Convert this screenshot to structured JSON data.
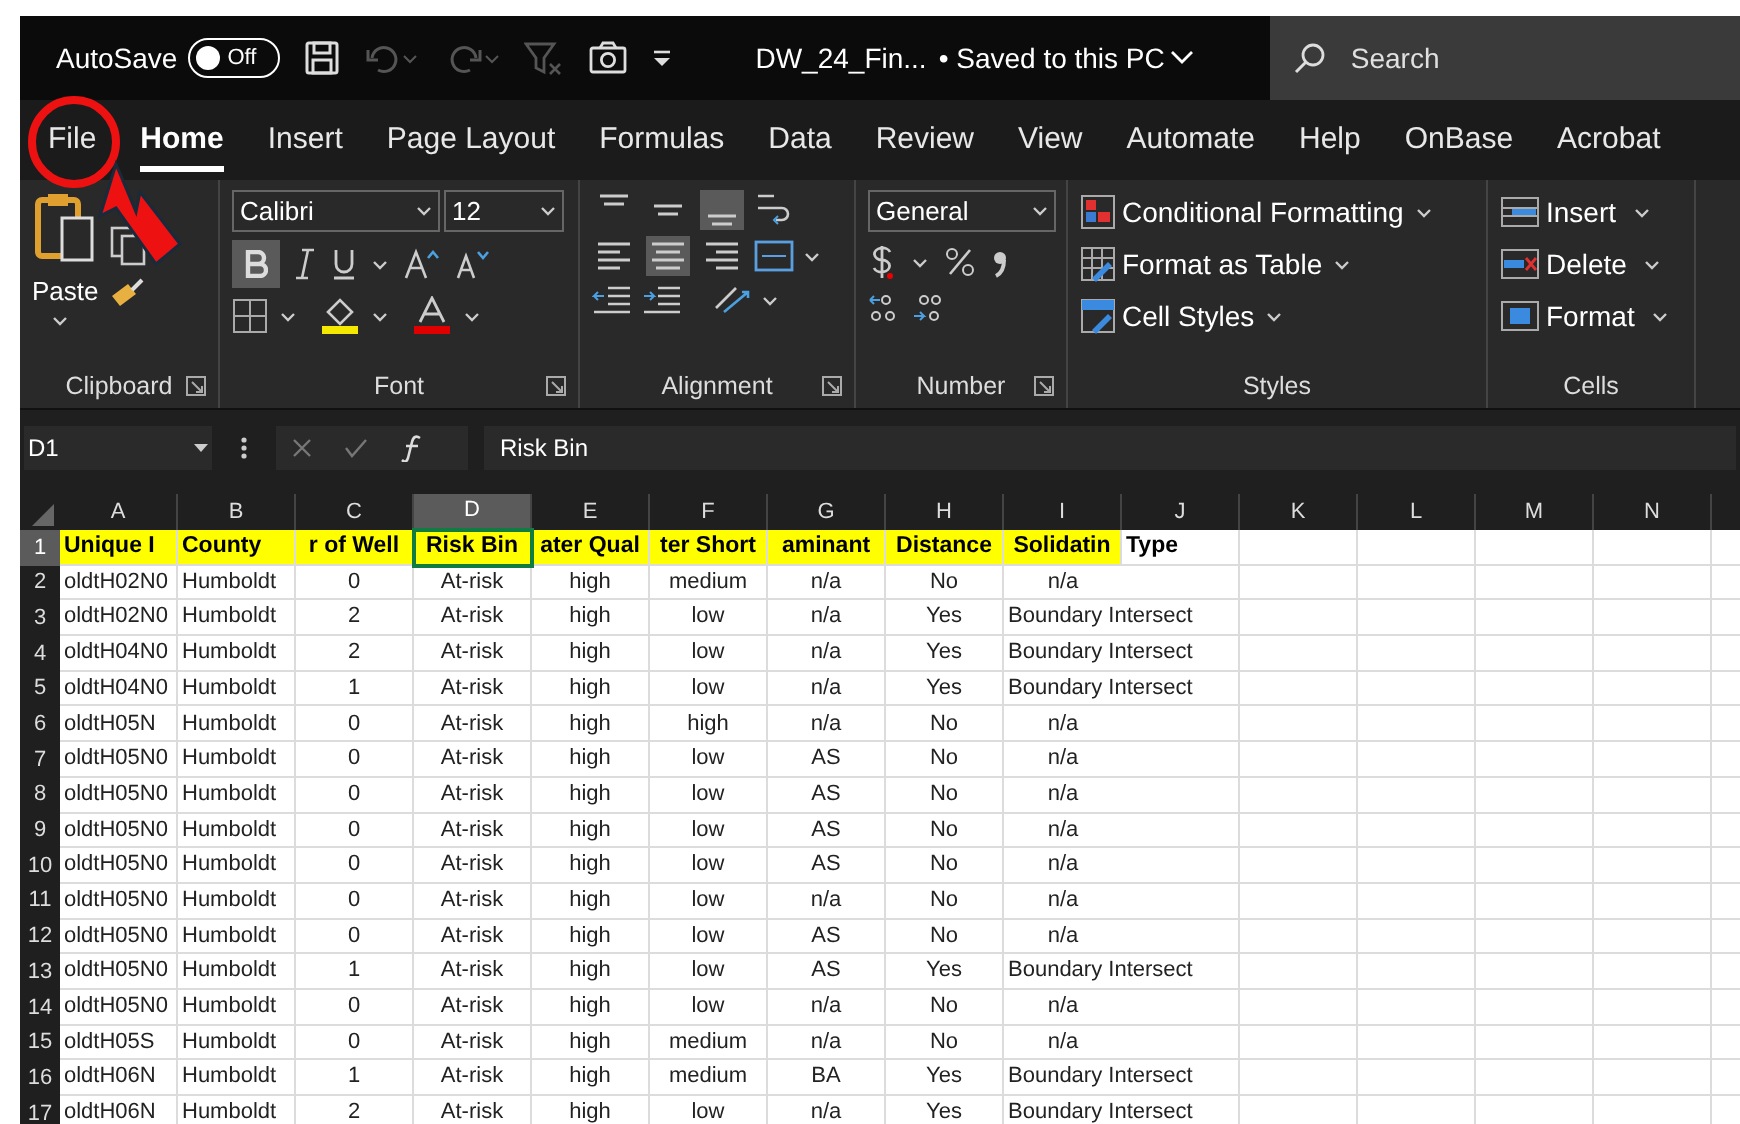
{
  "title_bar": {
    "autosave_label": "AutoSave",
    "autosave": {
      "on": false,
      "label": "Off"
    },
    "document_title": "DW_24_Fin...",
    "save_status": "• Saved to this PC",
    "search_placeholder": "Search"
  },
  "ribbon_tabs": [
    {
      "label": "File",
      "selected": false
    },
    {
      "label": "Home",
      "selected": true
    },
    {
      "label": "Insert",
      "selected": false
    },
    {
      "label": "Page Layout",
      "selected": false
    },
    {
      "label": "Formulas",
      "selected": false
    },
    {
      "label": "Data",
      "selected": false
    },
    {
      "label": "Review",
      "selected": false
    },
    {
      "label": "View",
      "selected": false
    },
    {
      "label": "Automate",
      "selected": false
    },
    {
      "label": "Help",
      "selected": false
    },
    {
      "label": "OnBase",
      "selected": false
    },
    {
      "label": "Acrobat",
      "selected": false
    }
  ],
  "ribbon": {
    "clipboard": {
      "paste_label": "Paste",
      "group_label": "Clipboard"
    },
    "font": {
      "name": "Calibri",
      "size": "12",
      "bold": true,
      "group_label": "Font"
    },
    "alignment": {
      "group_label": "Alignment"
    },
    "number": {
      "format": "General",
      "group_label": "Number"
    },
    "styles": {
      "items": [
        "Conditional Formatting",
        "Format as Table",
        "Cell Styles"
      ],
      "group_label": "Styles"
    },
    "cells": {
      "items": [
        "Insert",
        "Delete",
        "Format"
      ],
      "group_label": "Cells"
    }
  },
  "formula_bar": {
    "name_box": "D1",
    "formula": "Risk Bin"
  },
  "sheet": {
    "columns": [
      {
        "label": "A",
        "selected": false
      },
      {
        "label": "B",
        "selected": false
      },
      {
        "label": "C",
        "selected": false
      },
      {
        "label": "D",
        "selected": true
      },
      {
        "label": "E",
        "selected": false
      },
      {
        "label": "F",
        "selected": false
      },
      {
        "label": "G",
        "selected": false
      },
      {
        "label": "H",
        "selected": false
      },
      {
        "label": "I",
        "selected": false
      },
      {
        "label": "J",
        "selected": false
      },
      {
        "label": "K",
        "selected": false
      },
      {
        "label": "L",
        "selected": false
      },
      {
        "label": "M",
        "selected": false
      },
      {
        "label": "N",
        "selected": false
      }
    ],
    "rows": [
      {
        "number": "1",
        "kind": "header",
        "selected": true,
        "cells": [
          {
            "text": "Unique I",
            "highlight": true
          },
          {
            "text": "County",
            "highlight": true
          },
          {
            "text": "r of Well",
            "highlight": true
          },
          {
            "text": "Risk Bin",
            "highlight": true
          },
          {
            "text": "ater Qual",
            "highlight": true
          },
          {
            "text": "ter Short",
            "highlight": true
          },
          {
            "text": "aminant",
            "highlight": true
          },
          {
            "text": "Distance",
            "highlight": true
          },
          {
            "text": "Solidatin",
            "highlight": true
          },
          {
            "text": "Type",
            "highlight": false
          }
        ]
      },
      {
        "number": "2",
        "kind": "data",
        "selected": false,
        "cells": [
          "oldtH02N0",
          "Humboldt",
          "0",
          "At-risk",
          "high",
          "medium",
          "n/a",
          "No",
          "n/a"
        ]
      },
      {
        "number": "3",
        "kind": "data",
        "selected": false,
        "cells": [
          "oldtH02N0",
          "Humboldt",
          "2",
          "At-risk",
          "high",
          "low",
          "n/a",
          "Yes",
          "Boundary Intersect"
        ]
      },
      {
        "number": "4",
        "kind": "data",
        "selected": false,
        "cells": [
          "oldtH04N0",
          "Humboldt",
          "2",
          "At-risk",
          "high",
          "low",
          "n/a",
          "Yes",
          "Boundary Intersect"
        ]
      },
      {
        "number": "5",
        "kind": "data",
        "selected": false,
        "cells": [
          "oldtH04N0",
          "Humboldt",
          "1",
          "At-risk",
          "high",
          "low",
          "n/a",
          "Yes",
          "Boundary Intersect"
        ]
      },
      {
        "number": "6",
        "kind": "data",
        "selected": false,
        "cells": [
          "oldtH05N",
          "Humboldt",
          "0",
          "At-risk",
          "high",
          "high",
          "n/a",
          "No",
          "n/a"
        ]
      },
      {
        "number": "7",
        "kind": "data",
        "selected": false,
        "cells": [
          "oldtH05N0",
          "Humboldt",
          "0",
          "At-risk",
          "high",
          "low",
          "AS",
          "No",
          "n/a"
        ]
      },
      {
        "number": "8",
        "kind": "data",
        "selected": false,
        "cells": [
          "oldtH05N0",
          "Humboldt",
          "0",
          "At-risk",
          "high",
          "low",
          "AS",
          "No",
          "n/a"
        ]
      },
      {
        "number": "9",
        "kind": "data",
        "selected": false,
        "cells": [
          "oldtH05N0",
          "Humboldt",
          "0",
          "At-risk",
          "high",
          "low",
          "AS",
          "No",
          "n/a"
        ]
      },
      {
        "number": "10",
        "kind": "data",
        "selected": false,
        "cells": [
          "oldtH05N0",
          "Humboldt",
          "0",
          "At-risk",
          "high",
          "low",
          "AS",
          "No",
          "n/a"
        ]
      },
      {
        "number": "11",
        "kind": "data",
        "selected": false,
        "cells": [
          "oldtH05N0",
          "Humboldt",
          "0",
          "At-risk",
          "high",
          "low",
          "n/a",
          "No",
          "n/a"
        ]
      },
      {
        "number": "12",
        "kind": "data",
        "selected": false,
        "cells": [
          "oldtH05N0",
          "Humboldt",
          "0",
          "At-risk",
          "high",
          "low",
          "AS",
          "No",
          "n/a"
        ]
      },
      {
        "number": "13",
        "kind": "data",
        "selected": false,
        "cells": [
          "oldtH05N0",
          "Humboldt",
          "1",
          "At-risk",
          "high",
          "low",
          "AS",
          "Yes",
          "Boundary Intersect"
        ]
      },
      {
        "number": "14",
        "kind": "data",
        "selected": false,
        "cells": [
          "oldtH05N0",
          "Humboldt",
          "0",
          "At-risk",
          "high",
          "low",
          "n/a",
          "No",
          "n/a"
        ]
      },
      {
        "number": "15",
        "kind": "data",
        "selected": false,
        "cells": [
          "oldtH05S",
          "Humboldt",
          "0",
          "At-risk",
          "high",
          "medium",
          "n/a",
          "No",
          "n/a"
        ]
      },
      {
        "number": "16",
        "kind": "data",
        "selected": false,
        "cells": [
          "oldtH06N",
          "Humboldt",
          "1",
          "At-risk",
          "high",
          "medium",
          "BA",
          "Yes",
          "Boundary Intersect"
        ]
      },
      {
        "number": "17",
        "kind": "data",
        "selected": false,
        "cells": [
          "oldtH06N",
          "Humboldt",
          "2",
          "At-risk",
          "high",
          "low",
          "n/a",
          "Yes",
          "Boundary Intersect"
        ]
      }
    ]
  }
}
